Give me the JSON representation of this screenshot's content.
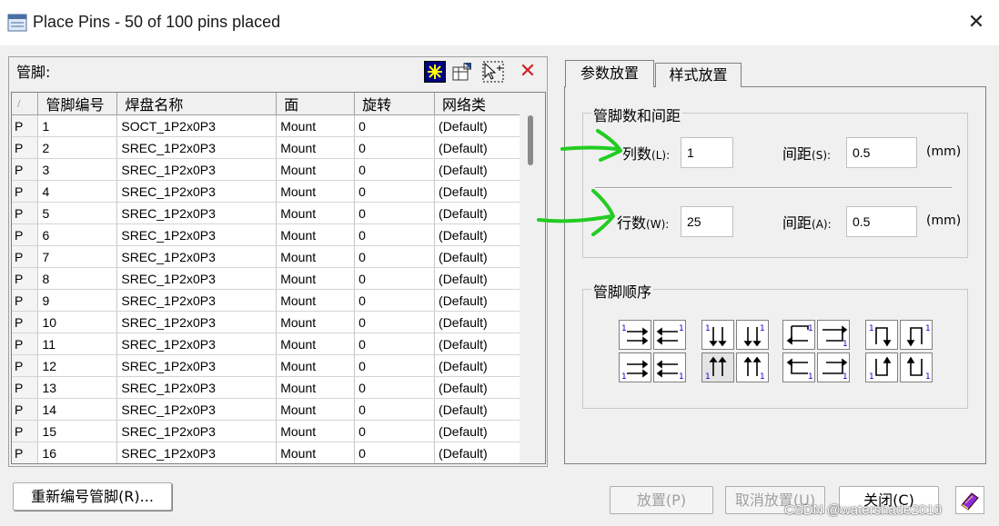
{
  "window": {
    "title": "Place Pins - 50 of 100 pins placed"
  },
  "pins": {
    "label": "管脚:",
    "columns": [
      "/",
      "管脚编号",
      "焊盘名称",
      "面",
      "旋转",
      "网络类"
    ],
    "rows": [
      [
        "P",
        "1",
        "SOCT_1P2x0P3",
        "Mount",
        "0",
        "(Default)"
      ],
      [
        "P",
        "2",
        "SREC_1P2x0P3",
        "Mount",
        "0",
        "(Default)"
      ],
      [
        "P",
        "3",
        "SREC_1P2x0P3",
        "Mount",
        "0",
        "(Default)"
      ],
      [
        "P",
        "4",
        "SREC_1P2x0P3",
        "Mount",
        "0",
        "(Default)"
      ],
      [
        "P",
        "5",
        "SREC_1P2x0P3",
        "Mount",
        "0",
        "(Default)"
      ],
      [
        "P",
        "6",
        "SREC_1P2x0P3",
        "Mount",
        "0",
        "(Default)"
      ],
      [
        "P",
        "7",
        "SREC_1P2x0P3",
        "Mount",
        "0",
        "(Default)"
      ],
      [
        "P",
        "8",
        "SREC_1P2x0P3",
        "Mount",
        "0",
        "(Default)"
      ],
      [
        "P",
        "9",
        "SREC_1P2x0P3",
        "Mount",
        "0",
        "(Default)"
      ],
      [
        "P",
        "10",
        "SREC_1P2x0P3",
        "Mount",
        "0",
        "(Default)"
      ],
      [
        "P",
        "11",
        "SREC_1P2x0P3",
        "Mount",
        "0",
        "(Default)"
      ],
      [
        "P",
        "12",
        "SREC_1P2x0P3",
        "Mount",
        "0",
        "(Default)"
      ],
      [
        "P",
        "13",
        "SREC_1P2x0P3",
        "Mount",
        "0",
        "(Default)"
      ],
      [
        "P",
        "14",
        "SREC_1P2x0P3",
        "Mount",
        "0",
        "(Default)"
      ],
      [
        "P",
        "15",
        "SREC_1P2x0P3",
        "Mount",
        "0",
        "(Default)"
      ],
      [
        "P",
        "16",
        "SREC_1P2x0P3",
        "Mount",
        "0",
        "(Default)"
      ]
    ]
  },
  "tabs": [
    "参数放置",
    "样式放置"
  ],
  "spacing_group": {
    "label": "管脚数和间距",
    "columns_label": "列数",
    "columns_key": "(L):",
    "columns_value": "1",
    "col_spacing_label": "间距",
    "col_spacing_key": "(S):",
    "col_spacing_value": "0.5",
    "rows_label": "行数",
    "rows_key": "(W):",
    "rows_value": "25",
    "row_spacing_label": "间距",
    "row_spacing_key": "(A):",
    "row_spacing_value": "0.5",
    "unit": "(mm)"
  },
  "order_group": {
    "label": "管脚顺序"
  },
  "buttons": {
    "renumber": "重新编号管脚(R)...",
    "place": "放置(P)",
    "unplace": "取消放置(U)",
    "close": "关闭(C)"
  },
  "watermark": "CSDN @watershade2010",
  "colors": {
    "annotation_green": "#22cc22",
    "arrow_blue": "#0000cc"
  }
}
